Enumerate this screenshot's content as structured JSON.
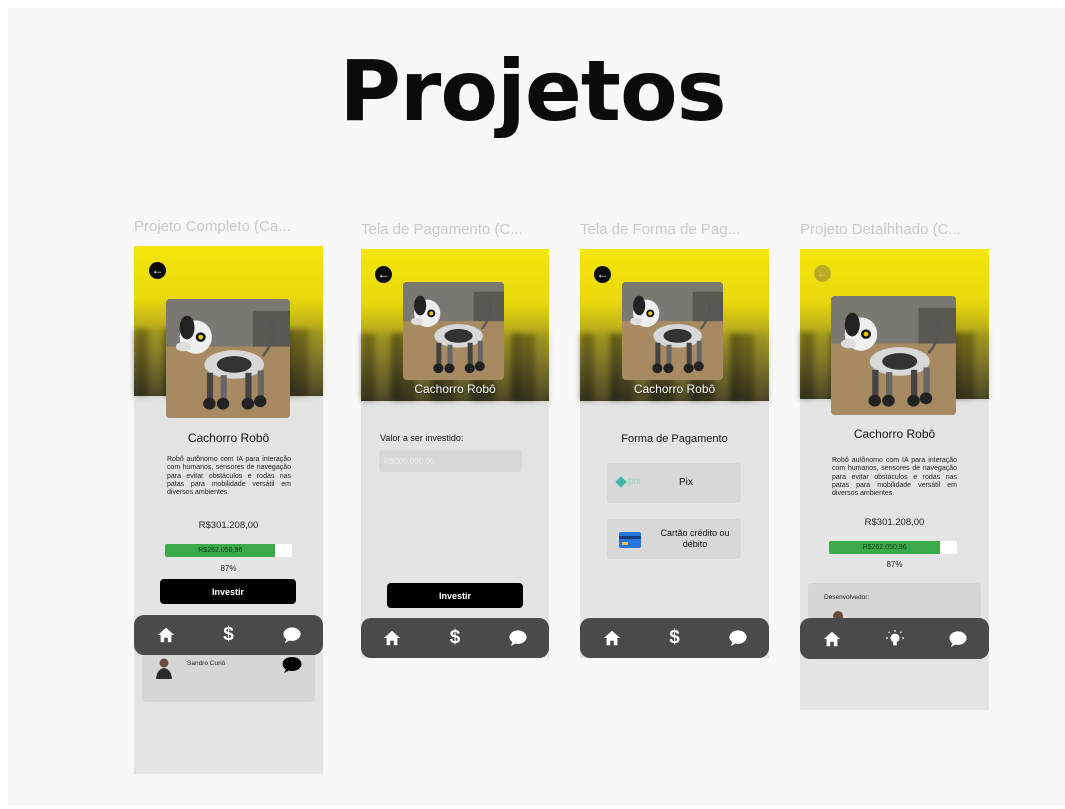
{
  "page": {
    "title": "Projetos"
  },
  "frames": [
    {
      "label": "Projeto Completo (Ca...",
      "image_caption": "",
      "name": "Cachorro Robô",
      "description": "Robô autônomo com IA para interação com humanos, sensores de navegação para evitar obstáculos e rodas nas patas para mobilidade versátil em diversos ambientes.",
      "price": "R$301.208,00",
      "progress_label": "R$262.050,96",
      "progress_fraction": 0.87,
      "percent": "87%",
      "invest_button": "Investir",
      "dev_name": "Sandro Curió",
      "nav": [
        "home-icon",
        "dollar-icon",
        "chat-icon"
      ]
    },
    {
      "label": "Tela de Pagamento (C...",
      "image_caption": "Cachorro Robô",
      "amount_label": "Valor a ser investido:",
      "amount_placeholder": "R$000.000,00",
      "invest_button": "Investir",
      "nav": [
        "home-icon",
        "dollar-icon",
        "chat-icon"
      ]
    },
    {
      "label": "Tela de Forma de Pag...",
      "image_caption": "Cachorro Robô",
      "heading": "Forma de Pagamento",
      "pix_logo_text": "pix",
      "pix_label": "Pix",
      "card_label_line1": "Cartão crédito ou",
      "card_label_line2": "débito",
      "nav": [
        "home-icon",
        "dollar-icon",
        "chat-icon"
      ]
    },
    {
      "label": "Projeto Detalhhado (C...",
      "name": "Cachorro Robô",
      "description": "Robô autônomo com IA para interação com humanos, sensores de navegação para evitar obstáculos e rodas nas patas para mobilidade versátil em diversos ambientes.",
      "price": "R$301.208,00",
      "progress_label": "R$262.050,96",
      "progress_fraction": 0.87,
      "percent": "87%",
      "dev_label": "Desenvolvedor:",
      "nav": [
        "home-icon",
        "lightbulb-icon",
        "chat-icon"
      ]
    }
  ],
  "colors": {
    "accent_yellow": "#f5e60a",
    "progress_green": "#3aaa4a",
    "navbar": "#4a4a4a",
    "frame_bg": "#e4e4e4"
  }
}
